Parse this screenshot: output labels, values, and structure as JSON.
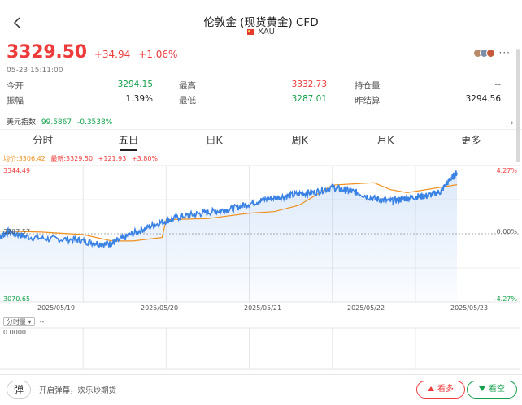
{
  "header": {
    "title": "伦敦金 (现货黄金) CFD",
    "code": "XAU"
  },
  "quote": {
    "price": "3329.50",
    "change": "+34.94",
    "change_pct": "+1.06%",
    "time": "05-23 15:11:00",
    "more": "···"
  },
  "stats": [
    {
      "label": "今开",
      "value": "3294.15",
      "color": "green"
    },
    {
      "label": "最高",
      "value": "3332.73",
      "color": "red"
    },
    {
      "label": "持仓量",
      "value": "--",
      "color": "dark"
    },
    {
      "label": "振幅",
      "value": "1.39%",
      "color": "dark"
    },
    {
      "label": "最低",
      "value": "3287.01",
      "color": "green"
    },
    {
      "label": "昨结算",
      "value": "3294.56",
      "color": "dark"
    }
  ],
  "usd_index": {
    "name": "美元指数",
    "value": "99.5867",
    "change_pct": "-0.3538%"
  },
  "tabs": [
    {
      "label": "分时",
      "active": false
    },
    {
      "label": "五日",
      "active": true
    },
    {
      "label": "日K",
      "active": false
    },
    {
      "label": "周K",
      "active": false
    },
    {
      "label": "月K",
      "active": false
    },
    {
      "label": "更多",
      "active": false
    }
  ],
  "legend": {
    "avg": "均价:3306.42",
    "latest": "最新:3329.50",
    "change": "+121.93",
    "change_pct": "+3.80%"
  },
  "colors": {
    "up": "#ee3b3b",
    "down": "#12a04a",
    "price_line": "#3a82e4",
    "avg_line": "#f0901d"
  },
  "chart_data": {
    "type": "line",
    "x": [
      "2025/05/19",
      "2025/05/20",
      "2025/05/21",
      "2025/05/22",
      "2025/05/23"
    ],
    "series": [
      {
        "name": "最新",
        "values": [
          [
            0.0,
            3201
          ],
          [
            0.1,
            3212
          ],
          [
            0.3,
            3202
          ],
          [
            0.6,
            3197
          ],
          [
            0.9,
            3196
          ],
          [
            1.1,
            3190
          ],
          [
            1.3,
            3186
          ],
          [
            1.4,
            3192
          ],
          [
            1.6,
            3208
          ],
          [
            1.8,
            3222
          ],
          [
            2.0,
            3234
          ],
          [
            2.2,
            3243
          ],
          [
            2.4,
            3248
          ],
          [
            2.6,
            3253
          ],
          [
            2.8,
            3258
          ],
          [
            3.0,
            3268
          ],
          [
            3.2,
            3277
          ],
          [
            3.4,
            3282
          ],
          [
            3.6,
            3288
          ],
          [
            3.8,
            3291
          ],
          [
            4.0,
            3301
          ],
          [
            4.15,
            3295
          ],
          [
            4.3,
            3290
          ],
          [
            4.5,
            3278
          ],
          [
            4.7,
            3273
          ],
          [
            4.85,
            3278
          ],
          [
            5.0,
            3282
          ],
          [
            5.15,
            3284
          ],
          [
            5.3,
            3292
          ],
          [
            5.42,
            3317
          ],
          [
            5.5,
            3330
          ]
        ]
      },
      {
        "name": "均价",
        "values": [
          [
            0.0,
            3213
          ],
          [
            0.5,
            3211
          ],
          [
            1.0,
            3206
          ],
          [
            1.35,
            3193
          ],
          [
            1.6,
            3193
          ],
          [
            1.95,
            3200
          ],
          [
            2.0,
            3236
          ],
          [
            2.5,
            3238
          ],
          [
            3.0,
            3249
          ],
          [
            3.3,
            3252
          ],
          [
            3.6,
            3265
          ],
          [
            4.0,
            3305
          ],
          [
            4.3,
            3308
          ],
          [
            4.5,
            3310
          ],
          [
            4.7,
            3296
          ],
          [
            4.9,
            3290
          ],
          [
            5.5,
            3306
          ]
        ]
      }
    ],
    "ylim": [
      3070.65,
      3344.49
    ],
    "yticks_left": [
      "3344.49",
      "3207.57",
      "3070.65"
    ],
    "yticks_right": [
      "4.27%",
      "0.00%",
      "-4.27%"
    ],
    "volume": {
      "label": "分时量",
      "value": "--",
      "zero": "0.0000"
    }
  },
  "bottom": {
    "danmu_label": "弹",
    "hint": "开启弹幕，欢乐炒期货",
    "bull": "看多",
    "bear": "看空"
  }
}
